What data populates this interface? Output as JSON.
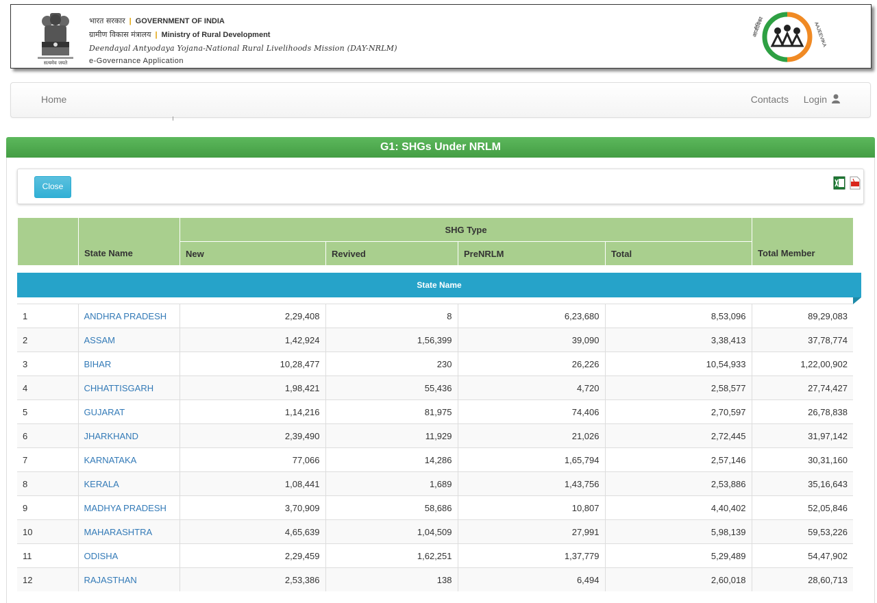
{
  "header": {
    "hi_govt": "भारत सरकार",
    "en_govt": "GOVERNMENT OF INDIA",
    "hi_ministry": "ग्रामीण विकास मंत्रालय",
    "en_ministry": "Ministry of Rural Development",
    "mission": "Deendayal Antyodaya Yojana-National Rural Livelihoods Mission (DAY-NRLM)",
    "app": "e-Governance Application",
    "emblem_motto": "सत्यमेव जयते",
    "logo_text": "AAJEEVIKA",
    "logo_text_hi": "आजीविका",
    "colors": {
      "logo_orange": "#f08a24",
      "logo_green": "#2ea043"
    }
  },
  "nav": {
    "home": "Home",
    "contacts": "Contacts",
    "login": "Login",
    "login_icon": "user-icon"
  },
  "panel": {
    "title": "G1:  SHGs Under NRLM",
    "close_label": "Close",
    "export_icons": [
      "excel-icon",
      "pdf-icon"
    ]
  },
  "table": {
    "headers": {
      "state_name": "State Name",
      "shg_type": "SHG Type",
      "new": "New",
      "revived": "Revived",
      "prenrlm": "PreNRLM",
      "total": "Total",
      "total_member": "Total Member"
    },
    "group_label": "State Name",
    "rows": [
      {
        "sno": "1",
        "state": "ANDHRA PRADESH",
        "new": "2,29,408",
        "revived": "8",
        "prenrlm": "6,23,680",
        "total": "8,53,096",
        "members": "89,29,083"
      },
      {
        "sno": "2",
        "state": "ASSAM",
        "new": "1,42,924",
        "revived": "1,56,399",
        "prenrlm": "39,090",
        "total": "3,38,413",
        "members": "37,78,774"
      },
      {
        "sno": "3",
        "state": "BIHAR",
        "new": "10,28,477",
        "revived": "230",
        "prenrlm": "26,226",
        "total": "10,54,933",
        "members": "1,22,00,902"
      },
      {
        "sno": "4",
        "state": "CHHATTISGARH",
        "new": "1,98,421",
        "revived": "55,436",
        "prenrlm": "4,720",
        "total": "2,58,577",
        "members": "27,74,427"
      },
      {
        "sno": "5",
        "state": "GUJARAT",
        "new": "1,14,216",
        "revived": "81,975",
        "prenrlm": "74,406",
        "total": "2,70,597",
        "members": "26,78,838"
      },
      {
        "sno": "6",
        "state": "JHARKHAND",
        "new": "2,39,490",
        "revived": "11,929",
        "prenrlm": "21,026",
        "total": "2,72,445",
        "members": "31,97,142"
      },
      {
        "sno": "7",
        "state": "KARNATAKA",
        "new": "77,066",
        "revived": "14,286",
        "prenrlm": "1,65,794",
        "total": "2,57,146",
        "members": "30,31,160"
      },
      {
        "sno": "8",
        "state": "KERALA",
        "new": "1,08,441",
        "revived": "1,689",
        "prenrlm": "1,43,756",
        "total": "2,53,886",
        "members": "35,16,643"
      },
      {
        "sno": "9",
        "state": "MADHYA PRADESH",
        "new": "3,70,909",
        "revived": "58,686",
        "prenrlm": "10,807",
        "total": "4,40,402",
        "members": "52,05,846"
      },
      {
        "sno": "10",
        "state": "MAHARASHTRA",
        "new": "4,65,639",
        "revived": "1,04,509",
        "prenrlm": "27,991",
        "total": "5,98,139",
        "members": "59,53,226"
      },
      {
        "sno": "11",
        "state": "ODISHA",
        "new": "2,29,459",
        "revived": "1,62,251",
        "prenrlm": "1,37,779",
        "total": "5,29,489",
        "members": "54,47,902"
      },
      {
        "sno": "12",
        "state": "RAJASTHAN",
        "new": "2,53,386",
        "revived": "138",
        "prenrlm": "6,494",
        "total": "2,60,018",
        "members": "28,60,713"
      }
    ]
  },
  "colors": {
    "panel_green": "#4cae4c",
    "header_green": "#a9cf8e",
    "band_blue": "#26a3c9",
    "link_blue": "#337ab7",
    "button_blue": "#5bc0de"
  }
}
